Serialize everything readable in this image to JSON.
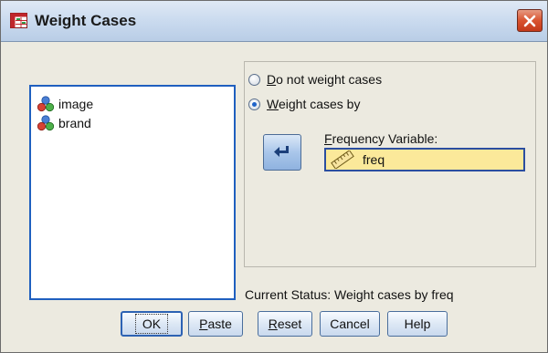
{
  "window": {
    "title": "Weight Cases",
    "close_icon": "close-icon",
    "app_icon": "spss-table-icon"
  },
  "variables": [
    {
      "name": "image",
      "icon": "nominal-variable-icon"
    },
    {
      "name": "brand",
      "icon": "nominal-variable-icon"
    }
  ],
  "options": {
    "do_not_weight": {
      "label_first": "D",
      "label_rest": "o not weight cases",
      "checked": false
    },
    "weight_by": {
      "label_first": "W",
      "label_rest": "eight cases by",
      "checked": true
    }
  },
  "frequency": {
    "label_first": "F",
    "label_rest": "requency Variable:",
    "value": "freq",
    "icon": "scale-variable-icon"
  },
  "move_button_icon": "arrow-left-icon",
  "status_text": "Current Status: Weight cases by freq",
  "buttons": {
    "ok": "OK",
    "paste_first": "P",
    "paste_rest": "aste",
    "reset_first": "R",
    "reset_rest": "eset",
    "cancel": "Cancel",
    "help": "Help"
  }
}
